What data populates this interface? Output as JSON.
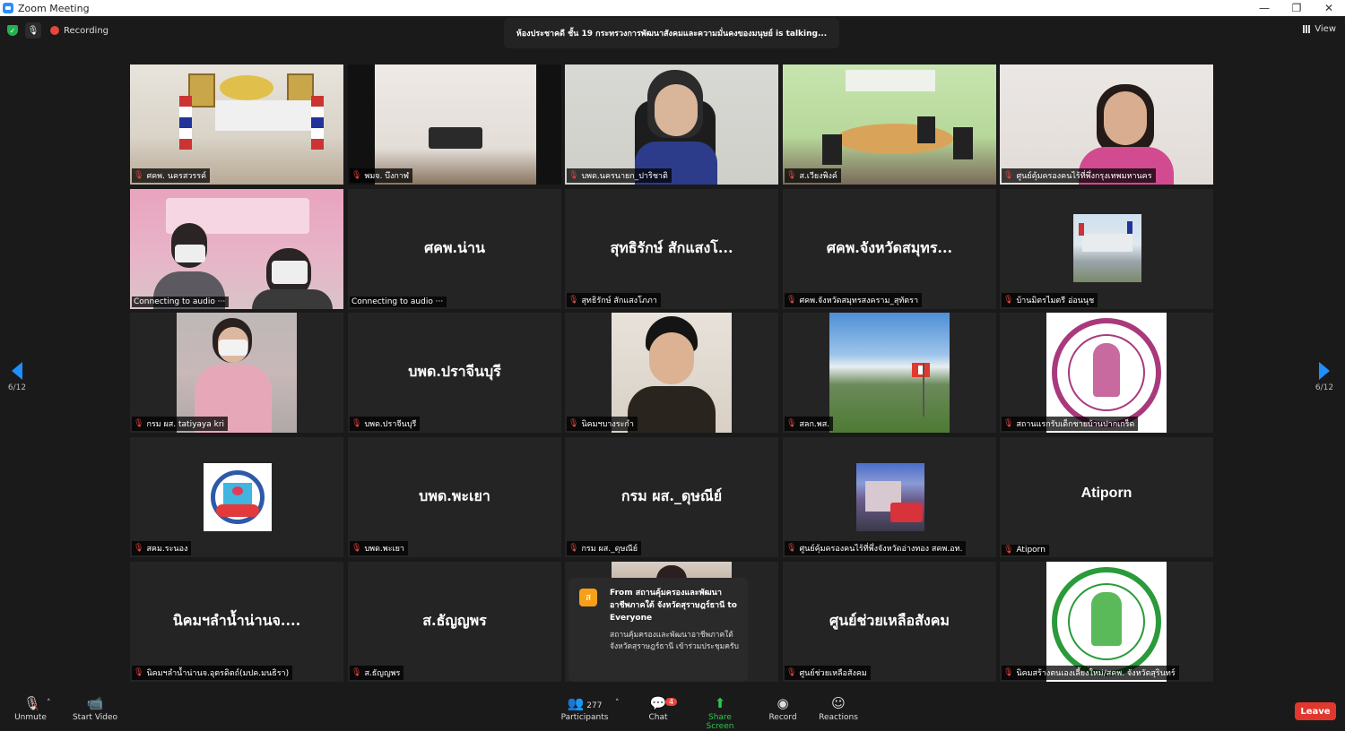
{
  "window": {
    "title": "Zoom Meeting",
    "controls": [
      "—",
      "❐",
      "✕"
    ]
  },
  "topbar": {
    "recording": "Recording",
    "talking": "ห้องประชาคดี ชั้น 19 กระทรวงการพัฒนาสังคมและความมั่นคงของมนุษย์ is  talking...",
    "view": "View"
  },
  "nav": {
    "page_left": "6/12",
    "page_right": "6/12"
  },
  "tiles": [
    {
      "label": "ศคพ. นครสวรรค์",
      "kind": "video"
    },
    {
      "label": "พมจ. บึงกาฬ",
      "kind": "video"
    },
    {
      "label": "บพด.นครนายก_ปาริชาติ",
      "kind": "video"
    },
    {
      "label": "ส.เวียงพิงค์",
      "kind": "video"
    },
    {
      "label": "ศูนย์คุ้มครองคนไร้ที่พึ่งกรุงเทพมหานคร",
      "kind": "video"
    },
    {
      "label": "Connecting to audio ···",
      "kind": "video"
    },
    {
      "label": "Connecting to audio ···",
      "kind": "name",
      "name": "ศคพ.น่าน"
    },
    {
      "label": "สุทธิรักษ์ สักแสงโภภา",
      "kind": "name",
      "name": "สุทธิรักษ์ สักแสงโ..."
    },
    {
      "label": "ศคพ.จังหวัดสมุทรสงคราม_สุทัตรา",
      "kind": "name",
      "name": "ศคพ.จังหวัดสมุทร..."
    },
    {
      "label": "บ้านมิตรไมตรี อ่อนนุช",
      "kind": "image"
    },
    {
      "label": "กรม ผส. tatiyaya kri",
      "kind": "video"
    },
    {
      "label": "บพด.ปราจีนบุรี",
      "kind": "name",
      "name": "บพด.ปราจีนบุรี"
    },
    {
      "label": "นิคมฯบางระกำ",
      "kind": "video"
    },
    {
      "label": "สลก.พส.",
      "kind": "image"
    },
    {
      "label": "สถานแรกรับเด็กชายบ้านปากเกร็ด",
      "kind": "image"
    },
    {
      "label": "สคม.ระนอง",
      "kind": "image"
    },
    {
      "label": "บพด.พะเยา",
      "kind": "name",
      "name": "บพด.พะเยา"
    },
    {
      "label": "กรม ผส._ดุษณีย์",
      "kind": "name",
      "name": "กรม ผส._ดุษณีย์"
    },
    {
      "label": "ศูนย์คุ้มครองคนไร้ที่พึ่งจังหวัดอ่างทอง สคพ.อท.",
      "kind": "image"
    },
    {
      "label": "Atiporn",
      "kind": "name",
      "name": "Atiporn"
    },
    {
      "label": "นิคมฯลำน้ำน่านจ.อุตรดิตถ์(มปค.มนธิรา)",
      "kind": "name",
      "name": "นิคมฯลำน้ำน่านจ...."
    },
    {
      "label": "ส.ธัญญพร",
      "kind": "name",
      "name": "ส.ธัญญพร"
    },
    {
      "label": "",
      "kind": "video"
    },
    {
      "label": "ศูนย์ช่วยเหลือสังคม",
      "kind": "name",
      "name": "ศูนย์ช่วยเหลือสังคม"
    },
    {
      "label": "นิคมสร้างตนเองเลี้ยงใหม่/สคพ. จังหวัดสุรินทร์",
      "kind": "image"
    }
  ],
  "chat_popup": {
    "avatar": "ส",
    "from": "From สถานคุ้มครองและพัฒนาอาชีพภาคใต้ จังหวัดสุราษฎร์ธานี to Everyone",
    "message": "สถานคุ้มครองและพัฒนาอาชีพภาคใต้ จังหวัดสุราษฎร์ธานี เข้าร่วมประชุมครับ"
  },
  "toolbar": {
    "unmute": "Unmute",
    "start_video": "Start Video",
    "participants": "Participants",
    "participants_count": "277",
    "chat": "Chat",
    "chat_badge": "4",
    "share": "Share Screen",
    "record": "Record",
    "reactions": "Reactions",
    "leave": "Leave"
  }
}
